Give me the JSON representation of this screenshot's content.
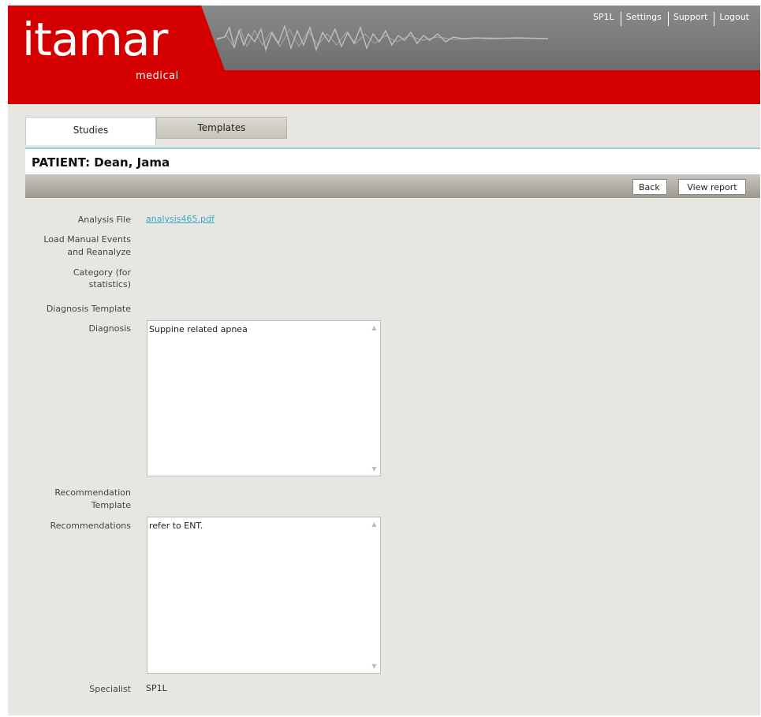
{
  "brand": {
    "logo": "itamar",
    "sub": "medical"
  },
  "topnav": [
    "SP1L",
    "Settings",
    "Support",
    "Logout"
  ],
  "tabs": {
    "studies": "Studies",
    "templates": "Templates"
  },
  "patient": {
    "title": "PATIENT: Dean, Jama"
  },
  "actions": {
    "back": "Back",
    "view_report": "View report"
  },
  "form": {
    "analysis_file_label": "Analysis File",
    "analysis_file_value": "analysis465.pdf",
    "load_manual_label_1": "Load Manual Events",
    "load_manual_label_2": "and Reanalyze",
    "category_label_1": "Category (for",
    "category_label_2": "statistics)",
    "diagnosis_template_label": "Diagnosis Template",
    "diagnosis_label": "Diagnosis",
    "diagnosis_value": "Suppine related apnea",
    "recommendation_template_label_1": "Recommendation",
    "recommendation_template_label_2": "Template",
    "recommendations_label": "Recommendations",
    "recommendations_value": "refer to ENT.",
    "specialist_label": "Specialist",
    "specialist_value": "SP1L"
  },
  "colors": {
    "brand_red": "#d40000",
    "link": "#3aa9c9",
    "tab_accent": "#8fd0e0"
  }
}
